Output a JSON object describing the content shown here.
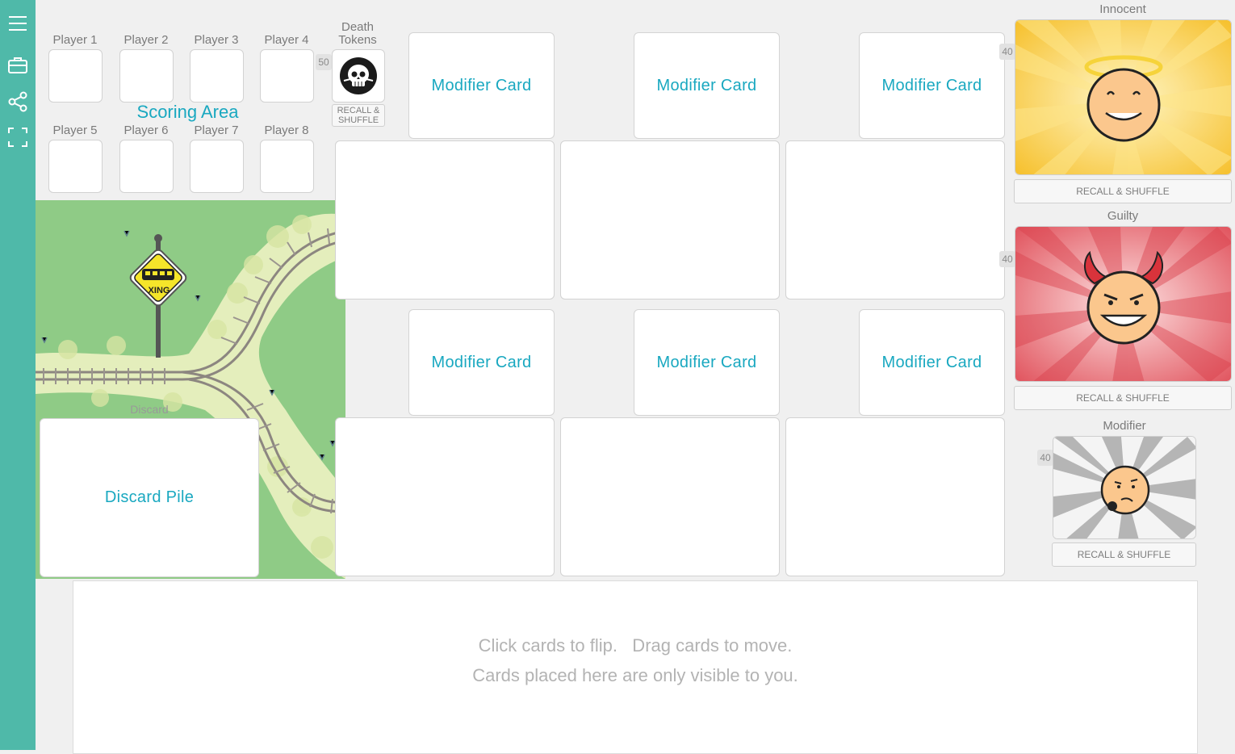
{
  "sidebar": {
    "items": [
      {
        "icon": "menu-icon"
      },
      {
        "icon": "briefcase-icon"
      },
      {
        "icon": "share-icon"
      },
      {
        "icon": "fullscreen-icon"
      }
    ]
  },
  "players": [
    "Player 1",
    "Player 2",
    "Player 3",
    "Player 4",
    "Player 5",
    "Player 6",
    "Player 7",
    "Player 8"
  ],
  "scoring_area_label": "Scoring Area",
  "death_tokens": {
    "label": "Death Tokens",
    "count": "50",
    "recall_label": "RECALL & SHUFFLE"
  },
  "modifier_cards": [
    "Modifier Card",
    "Modifier Card",
    "Modifier Card",
    "Modifier Card",
    "Modifier Card",
    "Modifier Card"
  ],
  "discard": {
    "label": "Discard",
    "pile_label": "Discard Pile"
  },
  "decks": {
    "innocent": {
      "title": "Innocent",
      "count": "40",
      "recall_label": "RECALL & SHUFFLE"
    },
    "guilty": {
      "title": "Guilty",
      "count": "40",
      "recall_label": "RECALL & SHUFFLE"
    },
    "modifier": {
      "title": "Modifier",
      "count": "40",
      "recall_label": "RECALL & SHUFFLE"
    }
  },
  "board_sign": "XING",
  "hand": {
    "line1": "Click cards to flip.   Drag cards to move.",
    "line2": "Cards placed here are only visible to you."
  },
  "colors": {
    "sidebar": "#4fb9a9",
    "card_text": "#19a8c0",
    "board_grass": "#8fcb86"
  }
}
